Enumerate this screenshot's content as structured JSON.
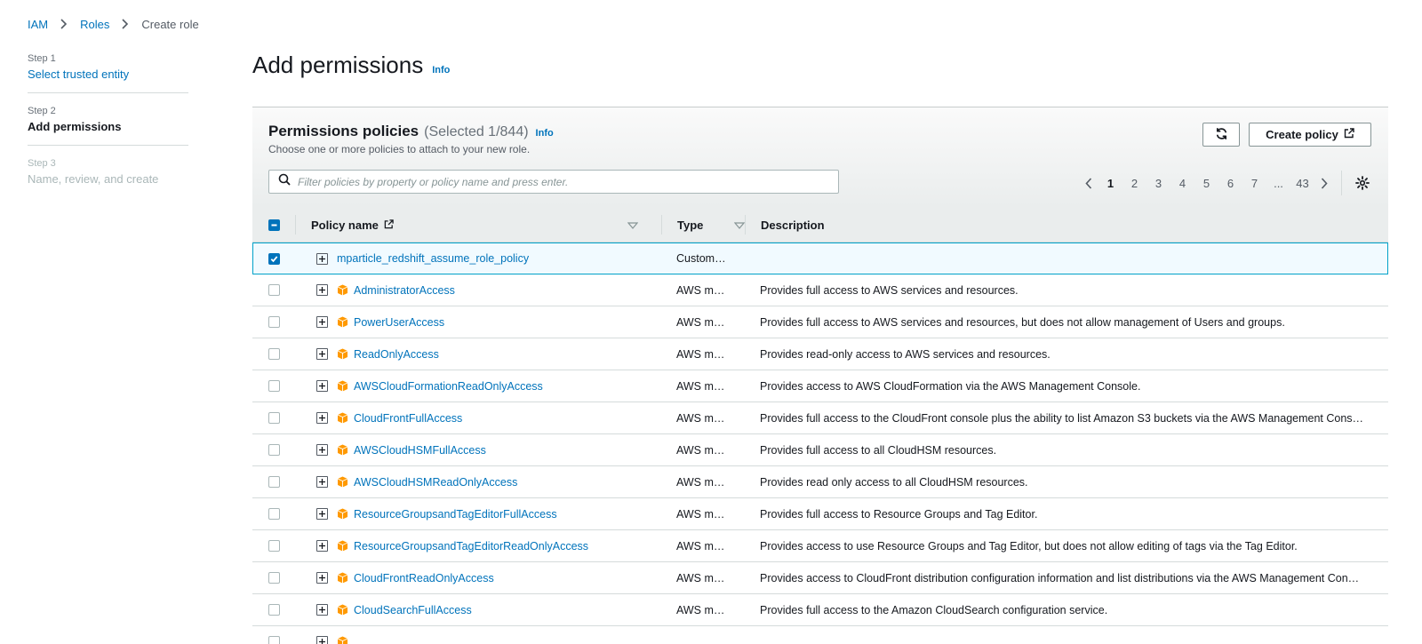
{
  "breadcrumb": {
    "items": [
      "IAM",
      "Roles"
    ],
    "current": "Create role"
  },
  "steps": [
    {
      "num": "Step 1",
      "label": "Select trusted entity"
    },
    {
      "num": "Step 2",
      "label": "Add permissions"
    },
    {
      "num": "Step 3",
      "label": "Name, review, and create"
    }
  ],
  "page": {
    "title": "Add permissions",
    "info": "Info"
  },
  "panel": {
    "title": "Permissions policies",
    "count": "(Selected 1/844)",
    "info": "Info",
    "description": "Choose one or more policies to attach to your new role.",
    "create_label": "Create policy",
    "search_placeholder": "Filter policies by property or policy name and press enter.",
    "pages": [
      "1",
      "2",
      "3",
      "4",
      "5",
      "6",
      "7",
      "...",
      "43"
    ],
    "current_page": "1"
  },
  "table": {
    "headers": {
      "name": "Policy name",
      "type": "Type",
      "description": "Description"
    },
    "rows": [
      {
        "name": "mparticle_redshift_assume_role_policy",
        "type": "Custom…",
        "description": "",
        "selected": true,
        "aws": false
      },
      {
        "name": "AdministratorAccess",
        "type": "AWS m…",
        "description": "Provides full access to AWS services and resources.",
        "selected": false,
        "aws": true
      },
      {
        "name": "PowerUserAccess",
        "type": "AWS m…",
        "description": "Provides full access to AWS services and resources, but does not allow management of Users and groups.",
        "selected": false,
        "aws": true
      },
      {
        "name": "ReadOnlyAccess",
        "type": "AWS m…",
        "description": "Provides read-only access to AWS services and resources.",
        "selected": false,
        "aws": true
      },
      {
        "name": "AWSCloudFormationReadOnlyAccess",
        "type": "AWS m…",
        "description": "Provides access to AWS CloudFormation via the AWS Management Console.",
        "selected": false,
        "aws": true
      },
      {
        "name": "CloudFrontFullAccess",
        "type": "AWS m…",
        "description": "Provides full access to the CloudFront console plus the ability to list Amazon S3 buckets via the AWS Management Cons…",
        "selected": false,
        "aws": true
      },
      {
        "name": "AWSCloudHSMFullAccess",
        "type": "AWS m…",
        "description": "Provides full access to all CloudHSM resources.",
        "selected": false,
        "aws": true
      },
      {
        "name": "AWSCloudHSMReadOnlyAccess",
        "type": "AWS m…",
        "description": "Provides read only access to all CloudHSM resources.",
        "selected": false,
        "aws": true
      },
      {
        "name": "ResourceGroupsandTagEditorFullAccess",
        "type": "AWS m…",
        "description": "Provides full access to Resource Groups and Tag Editor.",
        "selected": false,
        "aws": true
      },
      {
        "name": "ResourceGroupsandTagEditorReadOnlyAccess",
        "type": "AWS m…",
        "description": "Provides access to use Resource Groups and Tag Editor, but does not allow editing of tags via the Tag Editor.",
        "selected": false,
        "aws": true
      },
      {
        "name": "CloudFrontReadOnlyAccess",
        "type": "AWS m…",
        "description": "Provides access to CloudFront distribution configuration information and list distributions via the AWS Management Con…",
        "selected": false,
        "aws": true
      },
      {
        "name": "CloudSearchFullAccess",
        "type": "AWS m…",
        "description": "Provides full access to the Amazon CloudSearch configuration service.",
        "selected": false,
        "aws": true
      },
      {
        "name": "",
        "type": "",
        "description": "",
        "selected": false,
        "aws": true
      }
    ]
  },
  "colors": {
    "link": "#0073bb",
    "aws_icon": "#f90",
    "selected_border": "#00a1c9"
  }
}
